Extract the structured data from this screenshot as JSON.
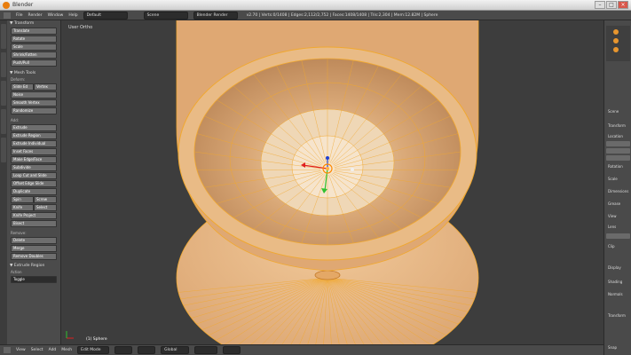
{
  "window": {
    "title": "Blender",
    "min": "–",
    "max": "□",
    "close": "×"
  },
  "infobar": {
    "menus": [
      "File",
      "Render",
      "Window",
      "Help"
    ],
    "layout": "Default",
    "scene": "Scene",
    "engine": "Blender Render",
    "stats": "v2.70 | Verts:0/1408 | Edges:2,112/2,752 | Faces:1408/1408 | Tris:2,304 | Mem:12.82M | Sphere"
  },
  "toolshelf": {
    "transform": {
      "header": "▼ Transform",
      "buttons": [
        "Translate",
        "Rotate",
        "Scale",
        "Shrink/Fatten",
        "Push/Pull"
      ]
    },
    "mesh_tools": {
      "header": "▼ Mesh Tools",
      "deform_label": "Deform:",
      "deform_row": [
        "Slide Ed",
        "Vertex"
      ],
      "deform_buttons": [
        "Noise",
        "Smooth Vertex",
        "Randomize"
      ]
    },
    "add": {
      "label": "Add:",
      "buttons": [
        "Extrude",
        "Extrude Region",
        "Extrude Individual",
        "Inset Faces",
        "Make Edge/Face",
        "Subdivide",
        "Loop Cut and Slide",
        "Offset Edge Slide",
        "Duplicate"
      ],
      "row1": [
        "Spin",
        "Screw"
      ],
      "row2": [
        "Knife",
        "Select"
      ],
      "buttons2": [
        "Knife Project",
        "Bisect"
      ]
    },
    "remove": {
      "label": "Remove:",
      "buttons": [
        "Delete",
        "Merge",
        "Remove Doubles"
      ]
    },
    "extrude_panel": {
      "header": "▼ Extrude Region",
      "label": "Action",
      "value": "Toggle"
    }
  },
  "viewport": {
    "label": "User Ortho",
    "object_label": "(1) Sphere"
  },
  "right_panel": {
    "items": [
      "Scene",
      "Transform",
      "Location",
      "Rotation",
      "Scale",
      "Dimensions",
      "Grease",
      "View",
      "Lens",
      "Clip",
      "Display",
      "Shading",
      "Normals",
      "Transform",
      "Snap"
    ]
  },
  "bottombar": {
    "menus": [
      "View",
      "Select",
      "Add",
      "Mesh"
    ],
    "mode": "Edit Mode",
    "pivot": "Global"
  },
  "colors": {
    "mesh": "#e7b57a",
    "wire": "#f0a830",
    "background": "#3d3d3d"
  }
}
